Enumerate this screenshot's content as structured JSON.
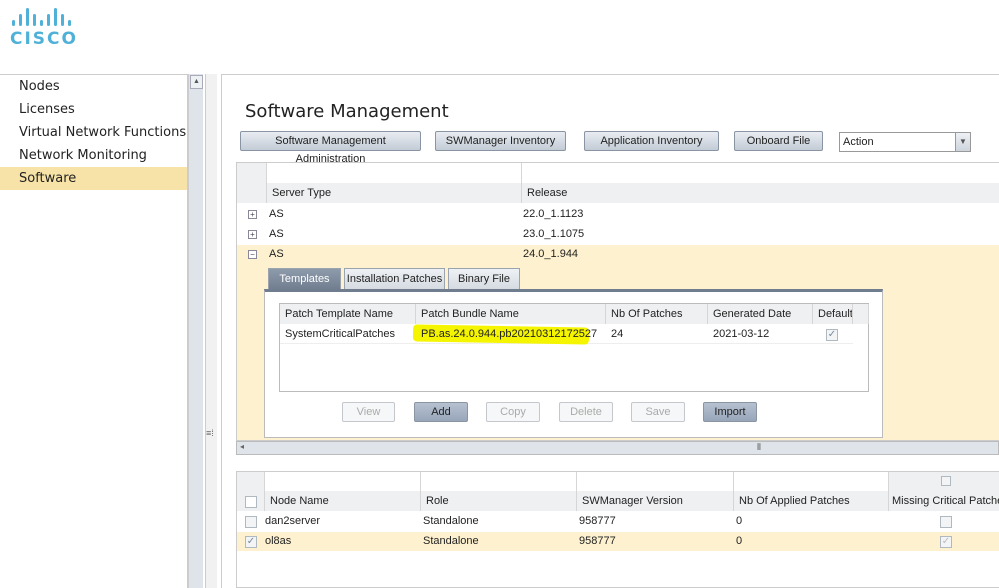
{
  "logo": {
    "text": "CISCO"
  },
  "sidebar": {
    "items": [
      {
        "label": "Nodes"
      },
      {
        "label": "Licenses"
      },
      {
        "label": "Virtual Network Functions"
      },
      {
        "label": "Network Monitoring"
      },
      {
        "label": "Software",
        "selected": true
      }
    ]
  },
  "main": {
    "title": "Software Management",
    "toolbar": {
      "buttons": [
        "Software Management Administration",
        "SWManager Inventory",
        "Application Inventory",
        "Onboard File"
      ],
      "action_select": "Action"
    },
    "server_grid": {
      "columns": [
        "Server Type",
        "Release"
      ],
      "rows": [
        {
          "type": "AS",
          "release": "22.0_1.1123",
          "expanded": false
        },
        {
          "type": "AS",
          "release": "23.0_1.1075",
          "expanded": false
        },
        {
          "type": "AS",
          "release": "24.0_1.944",
          "expanded": true
        }
      ]
    },
    "tabs": [
      "Templates",
      "Installation Patches",
      "Binary File"
    ],
    "templates": {
      "columns": [
        "Patch Template Name",
        "Patch Bundle Name",
        "Nb Of Patches",
        "Generated Date",
        "Default"
      ],
      "rows": [
        {
          "name": "SystemCriticalPatches",
          "bundle": "PB.as.24.0.944.pb20210312172527",
          "patches": "24",
          "date": "2021-03-12",
          "default": true
        }
      ],
      "highlight_color": "#f5f500"
    },
    "template_buttons": [
      {
        "label": "View",
        "enabled": false
      },
      {
        "label": "Add",
        "enabled": true
      },
      {
        "label": "Copy",
        "enabled": false
      },
      {
        "label": "Delete",
        "enabled": false
      },
      {
        "label": "Save",
        "enabled": false
      },
      {
        "label": "Import",
        "enabled": true
      }
    ],
    "node_grid": {
      "columns": [
        "Node Name",
        "Role",
        "SWManager Version",
        "Nb Of Applied Patches",
        "Missing Critical Patches"
      ],
      "rows": [
        {
          "node": "dan2server",
          "role": "Standalone",
          "version": "958777",
          "applied": "0",
          "checked": false,
          "missing": false
        },
        {
          "node": "ol8as",
          "role": "Standalone",
          "version": "958777",
          "applied": "0",
          "checked": true,
          "missing": true
        }
      ]
    }
  },
  "colors": {
    "selected_row": "#fdf1cf",
    "sidebar_selected": "#f7e3a7",
    "brand": "#4fb1d8"
  }
}
